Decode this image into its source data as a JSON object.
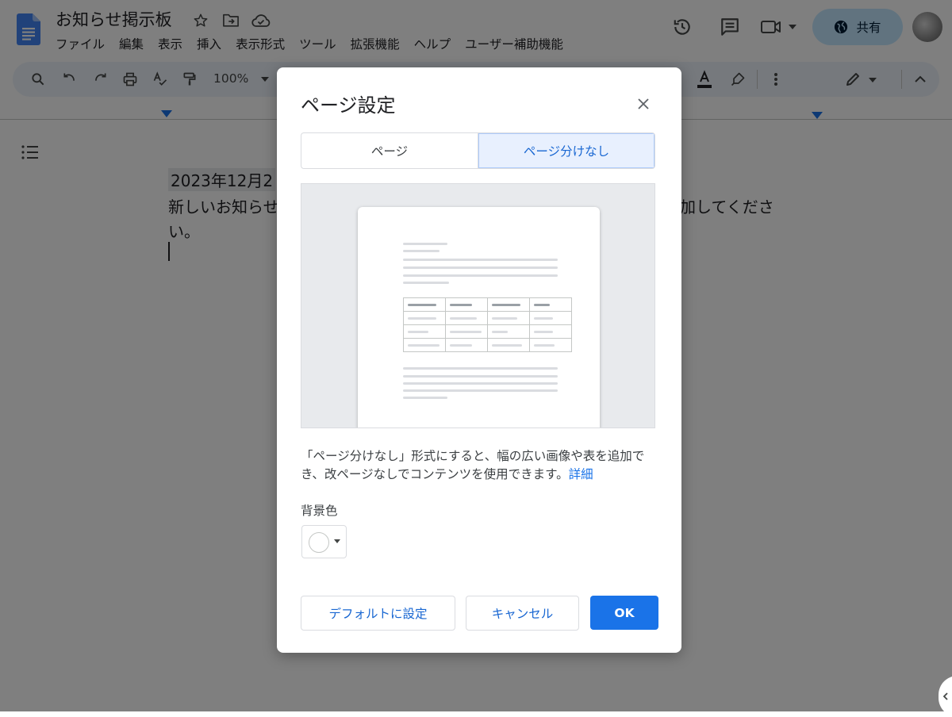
{
  "header": {
    "title": "お知らせ掲示板",
    "icons": [
      "star-icon",
      "move-folder-icon",
      "cloud-status-icon"
    ],
    "menu": [
      "ファイル",
      "編集",
      "表示",
      "挿入",
      "表示形式",
      "ツール",
      "拡張機能",
      "ヘルプ",
      "ユーザー補助機能"
    ],
    "right_icons": [
      "history-icon",
      "comment-icon",
      "meet-icon"
    ],
    "share_label": "共有",
    "brand_color": "#1a73e8",
    "share_bg": "#c2e7ff"
  },
  "toolbar": {
    "zoom": "100%",
    "left_icons": [
      "search-icon",
      "undo-icon",
      "redo-icon",
      "print-icon",
      "spellcheck-icon",
      "paint-format-icon"
    ],
    "right_icons": [
      "text-color-icon",
      "highlight-icon",
      "more-icon",
      "edit-mode-icon",
      "collapse-icon"
    ]
  },
  "document": {
    "line1": "2023年12月2",
    "line2": "新しいお知らせ",
    "line2_tail": "加してくださ",
    "line3": "い。"
  },
  "dialog": {
    "title": "ページ設定",
    "tabs": [
      "ページ",
      "ページ分けなし"
    ],
    "selected_tab": "ページ分けなし",
    "description": "「ページ分けなし」形式にすると、幅の広い画像や表を追加でき、改ページなしでコンテンツを使用できます。",
    "learn_more": "詳細",
    "background_color_label": "背景色",
    "background_color_value": "#ffffff",
    "buttons": {
      "default": "デフォルトに設定",
      "cancel": "キャンセル",
      "ok": "OK"
    }
  }
}
